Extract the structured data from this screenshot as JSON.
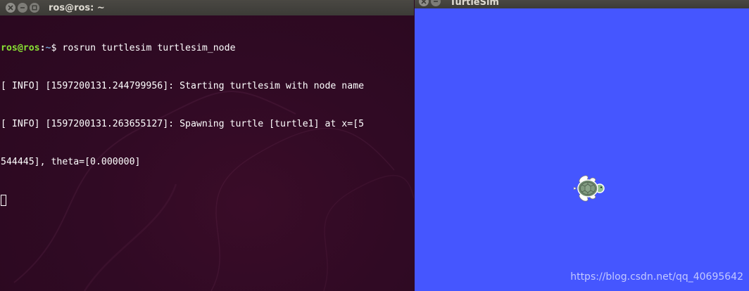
{
  "terminal": {
    "title": "ros@ros: ~",
    "prompt": {
      "user_host": "ros@ros",
      "separator": ":",
      "path": "~",
      "symbol": "$"
    },
    "command": " rosrun turtlesim turtlesim_node",
    "output_lines": [
      "[ INFO] [1597200131.244799956]: Starting turtlesim with node name",
      "[ INFO] [1597200131.263655127]: Spawning turtle [turtle1] at x=[5",
      "544445], theta=[0.000000]"
    ]
  },
  "turtlesim": {
    "title": "TurtleSim",
    "background_color": "#4556ff",
    "watermark": "https://blog.csdn.net/qq_40695642"
  },
  "colors": {
    "terminal_bg": "#300a24",
    "prompt_user": "#8ae234",
    "prompt_path": "#729fcf",
    "titlebar": "#3c3b37"
  }
}
